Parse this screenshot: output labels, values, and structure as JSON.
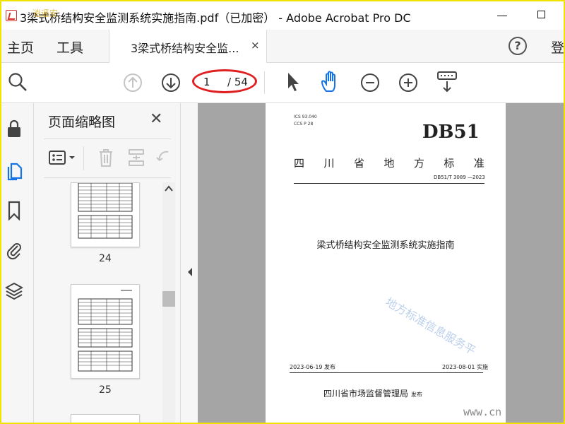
{
  "window": {
    "title": "3梁式桥结构安全监测系统实施指南.pdf（已加密） - Adobe Acrobat Pro DC"
  },
  "menubar": {
    "home": "主页",
    "tools": "工具",
    "tab_label": "3梁式桥结构安全监...",
    "tab_close": "×",
    "help": "?",
    "login": "登"
  },
  "toolbar": {
    "page_current": "1",
    "page_total": "/ 54"
  },
  "thumbnail_panel": {
    "title": "页面缩略图",
    "close": "✕",
    "pages": [
      {
        "number": "24"
      },
      {
        "number": "25"
      }
    ]
  },
  "document_page": {
    "ics": "ICS  93.040",
    "ccs": "CCS  P 28",
    "code": "DB51",
    "province_chars": [
      "四",
      "川",
      "省",
      "地",
      "方",
      "标",
      "准"
    ],
    "std_number": "DB51/T 3089 —2023",
    "title": "梁式桥结构安全监测系统实施指南",
    "issue_date": "2023-06-19 发布",
    "impl_date": "2023-08-01 实施",
    "issuer": "四川省市场监督管理局",
    "issuer_suffix": "发布",
    "watermark": "地方标准信息服务平"
  },
  "overlays": {
    "corner_url": "www.cn",
    "top_logo": "逍遥安"
  },
  "colors": {
    "highlight_ellipse": "#e02020",
    "frame_border": "#f1e300",
    "hand_tool": "#1473e6",
    "active_rail_icon": "#1473e6"
  }
}
